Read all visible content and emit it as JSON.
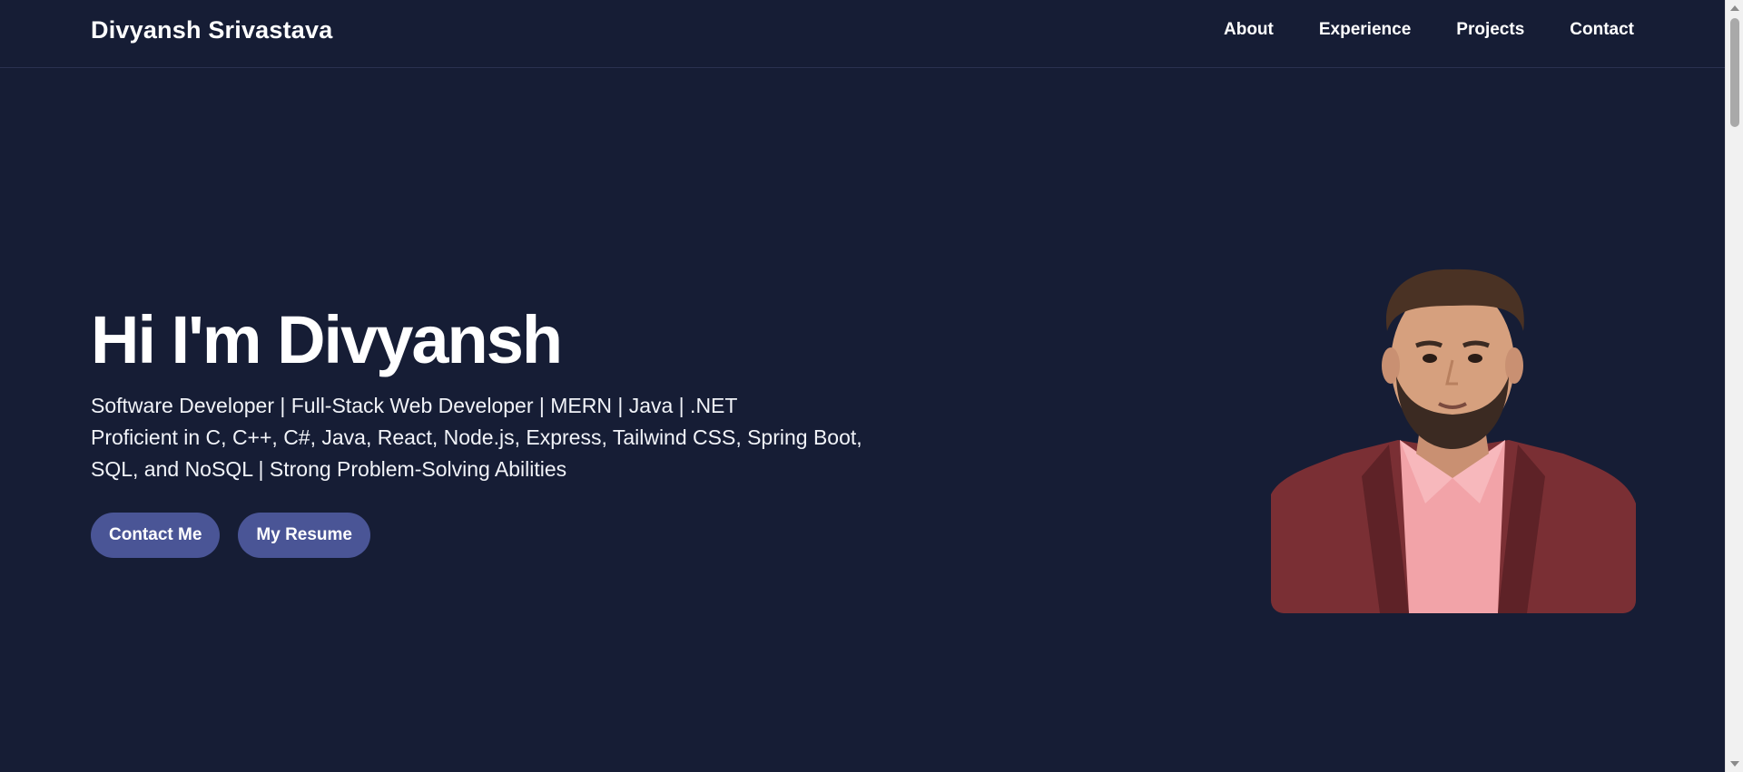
{
  "header": {
    "brand": "Divyansh Srivastava",
    "nav": [
      {
        "label": "About"
      },
      {
        "label": "Experience"
      },
      {
        "label": "Projects"
      },
      {
        "label": "Contact"
      }
    ]
  },
  "hero": {
    "title": "Hi I'm Divyansh",
    "subtitle_lines": [
      "Software Developer | Full-Stack Web Developer | MERN | Java | .NET",
      "Proficient in C, C++, C#, Java, React, Node.js, Express, Tailwind CSS, Spring Boot,",
      "SQL, and NoSQL | Strong Problem-Solving Abilities"
    ],
    "buttons": {
      "contact": "Contact Me",
      "resume": "My Resume"
    }
  },
  "portrait": {
    "icon": "profile-photo"
  },
  "colors": {
    "background": "#161d35",
    "button": "#4a5596",
    "text": "#ffffff",
    "jacket": "#7a2f34",
    "shirt": "#f2a3a8"
  }
}
